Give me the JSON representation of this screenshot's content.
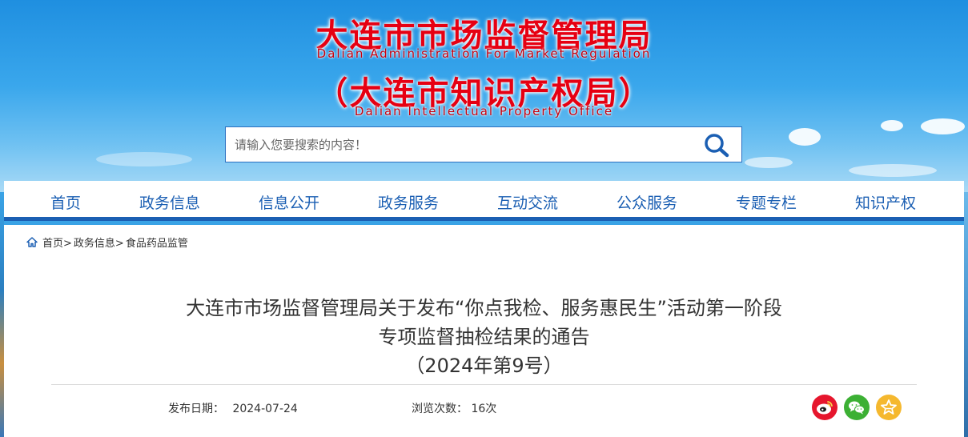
{
  "header": {
    "title_cn": "大连市市场监督管理局",
    "title_en": "Dalian Administration For Market Regulation",
    "subtitle_cn": "（大连市知识产权局）",
    "subtitle_en": "Dalian Intellectual Property Office"
  },
  "search": {
    "placeholder": "请输入您要搜索的内容！",
    "icon": "search-icon"
  },
  "nav": {
    "items": [
      "首页",
      "政务信息",
      "信息公开",
      "政务服务",
      "互动交流",
      "公众服务",
      "专题专栏",
      "知识产权"
    ]
  },
  "breadcrumb": {
    "icon": "home-icon",
    "items": [
      "首页>",
      "政务信息>",
      "食品药品监管"
    ]
  },
  "article": {
    "title_line1": "大连市市场监督管理局关于发布“你点我检、服务惠民生”活动第一阶段",
    "title_line2": "专项监督抽检结果的通告",
    "title_line3": "（2024年第9号）",
    "date_label": "发布日期：",
    "date_value": "2024-07-24",
    "views_label": "浏览次数：",
    "views_value": "16次"
  },
  "share": {
    "weibo_icon": "weibo-icon",
    "wechat_icon": "wechat-icon",
    "favorite_icon": "star-icon"
  },
  "colors": {
    "brand_red": "#e60012",
    "nav_blue": "#1b5fb3",
    "weibo_red": "#e6162d",
    "wechat_green": "#3cb034",
    "favorite_yellow": "#f5b82e"
  }
}
